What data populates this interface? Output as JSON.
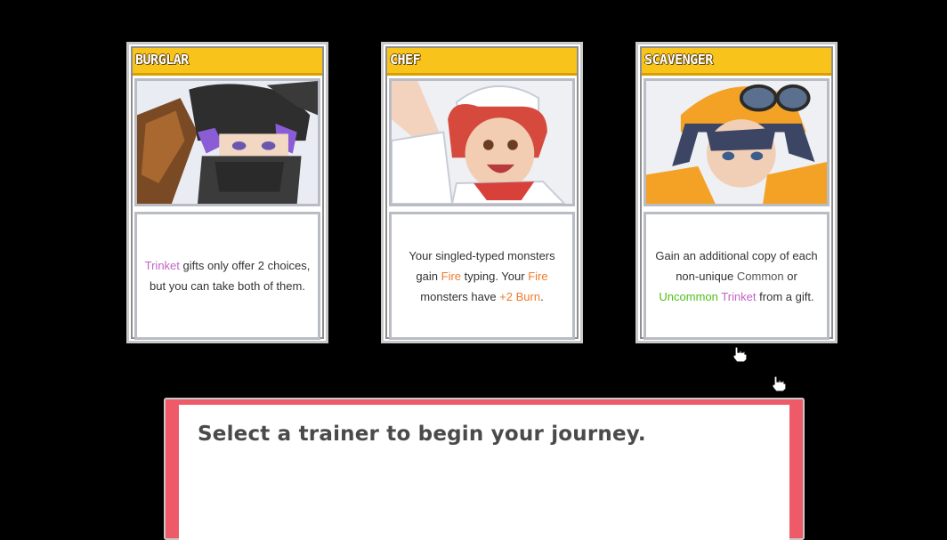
{
  "cards": [
    {
      "title": "BURGLAR",
      "portrait_icon": "ninja-trainer-portrait",
      "desc": [
        {
          "text": "Trinket",
          "kw": "trinket"
        },
        {
          "text": " gifts only offer 2 choices, but you can take both of them."
        }
      ]
    },
    {
      "title": "CHEF",
      "portrait_icon": "chef-trainer-portrait",
      "desc": [
        {
          "text": "Your singled-typed monsters gain "
        },
        {
          "text": "Fire",
          "kw": "fire"
        },
        {
          "text": " typing. Your "
        },
        {
          "text": "Fire",
          "kw": "fire"
        },
        {
          "text": " monsters have "
        },
        {
          "text": "+2 Burn",
          "kw": "fire"
        },
        {
          "text": "."
        }
      ]
    },
    {
      "title": "SCAVENGER",
      "portrait_icon": "goggles-trainer-portrait",
      "desc": [
        {
          "text": "Gain an additional copy of each non-unique "
        },
        {
          "text": "Common",
          "kw": "common"
        },
        {
          "text": " or "
        },
        {
          "text": "Uncommon",
          "kw": "uncommon"
        },
        {
          "text": " "
        },
        {
          "text": "Trinket",
          "kw": "trinket"
        },
        {
          "text": " from a gift."
        }
      ]
    }
  ],
  "dialog": {
    "message": "Select a trainer to begin your journey."
  },
  "colors": {
    "title_bar": "#f8c41c",
    "dialog_frame": "#ee5a68",
    "trinket": "#c264c4",
    "fire": "#f07a2c",
    "uncommon": "#4fbf18"
  }
}
